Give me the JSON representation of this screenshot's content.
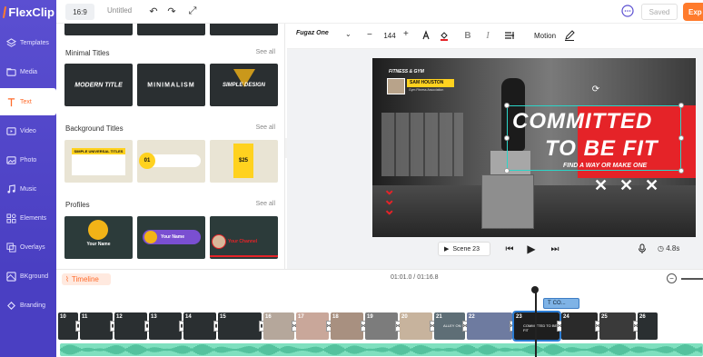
{
  "app": {
    "logo": "FlexClip"
  },
  "sidebar": {
    "items": [
      {
        "label": "Templates",
        "icon": "layers-icon"
      },
      {
        "label": "Media",
        "icon": "folder-icon"
      },
      {
        "label": "Text",
        "icon": "text-icon",
        "active": true
      },
      {
        "label": "Video",
        "icon": "video-icon"
      },
      {
        "label": "Photo",
        "icon": "image-icon"
      },
      {
        "label": "Music",
        "icon": "music-icon"
      },
      {
        "label": "Elements",
        "icon": "shapes-icon"
      },
      {
        "label": "Overlays",
        "icon": "overlay-icon"
      },
      {
        "label": "BKground",
        "icon": "background-icon"
      },
      {
        "label": "Branding",
        "icon": "branding-icon"
      }
    ]
  },
  "topbar": {
    "ratio": "16:9",
    "title": "Untitled",
    "saved": "Saved",
    "export": "Exp"
  },
  "panel": {
    "sections": [
      {
        "title": "Minimal Titles",
        "see_all": "See all",
        "items": [
          "MODERN TITLE",
          "MINIMALISM",
          "SIMPLE DESIGN"
        ]
      },
      {
        "title": "Background Titles",
        "see_all": "See all",
        "items": [
          "SIMPLE UNIVERSAL TITLES",
          "01",
          "$25"
        ]
      },
      {
        "title": "Profiles",
        "see_all": "See all",
        "items": [
          "Your Name",
          "Your Name",
          "Your Channel"
        ]
      }
    ]
  },
  "text_toolbar": {
    "font": "Fugaz One",
    "size": "144",
    "motion": "Motion"
  },
  "canvas": {
    "fitness_label": "FITNESS & GYM",
    "name": "SAM HOUSTON",
    "name_sub": "Gym Fitness Association",
    "headline_1": "COMMITTED",
    "headline_2": "TO BE FIT",
    "subline": "FIND A WAY OR MAKE ONE",
    "colors": {
      "accent_red": "#e52328",
      "selection": "#2bd5c8",
      "yellow": "#ffd21f"
    }
  },
  "player": {
    "scene": "Scene 23",
    "duration": "4.8s"
  },
  "timeline": {
    "label": "Timeline",
    "time": "01:01.0 / 01:16.8",
    "text_chip": "CO...",
    "clips": [
      {
        "num": "10",
        "label": ""
      },
      {
        "num": "11",
        "label": ""
      },
      {
        "num": "12",
        "label": ""
      },
      {
        "num": "13",
        "label": ""
      },
      {
        "num": "14",
        "label": ""
      },
      {
        "num": "15",
        "label": ""
      },
      {
        "num": "16",
        "label": ""
      },
      {
        "num": "17",
        "label": ""
      },
      {
        "num": "18",
        "label": ""
      },
      {
        "num": "19",
        "label": ""
      },
      {
        "num": "20",
        "label": ""
      },
      {
        "num": "21",
        "label": "ALLEY ON"
      },
      {
        "num": "22",
        "label": ""
      },
      {
        "num": "23",
        "label": "COMMITTED TO BE FIT"
      },
      {
        "num": "24",
        "label": ""
      },
      {
        "num": "25",
        "label": ""
      },
      {
        "num": "26",
        "label": ""
      }
    ]
  }
}
